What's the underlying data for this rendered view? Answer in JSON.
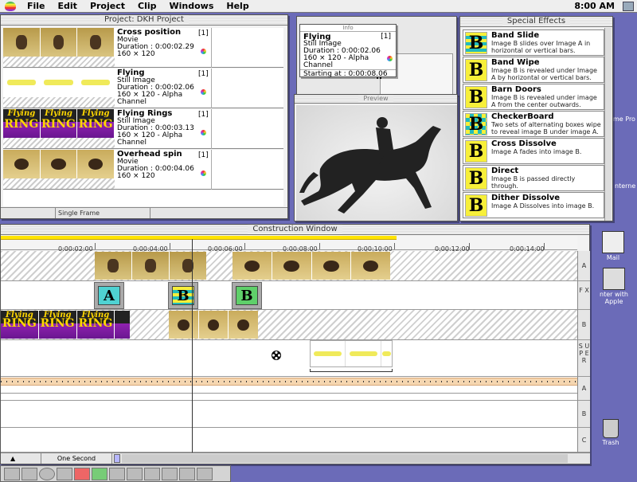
{
  "menubar": {
    "items": [
      "File",
      "Edit",
      "Project",
      "Clip",
      "Windows",
      "Help"
    ],
    "clock": "8:00 AM"
  },
  "project": {
    "title": "Project: DKH Project",
    "footer_label": "Single Frame",
    "clips": [
      {
        "name": "Cross position",
        "type": "Movie",
        "duration": "Duration : 0:00:02.29",
        "size": "160 × 120",
        "index": "[1]"
      },
      {
        "name": "Flying",
        "type": "Still Image",
        "duration": "Duration : 0:00:02.06",
        "size": "160 × 120 - Alpha Channel",
        "index": "[1]"
      },
      {
        "name": "Flying Rings",
        "type": "Still Image",
        "duration": "Duration : 0:00:03.13",
        "size": "160 × 120 - Alpha Channel",
        "index": "[1]"
      },
      {
        "name": "Overhead spin",
        "type": "Movie",
        "duration": "Duration : 0:00:04.06",
        "size": "160 × 120",
        "index": "[1]"
      }
    ],
    "ring_text": [
      "Flying",
      "RING"
    ]
  },
  "info": {
    "title": "Info",
    "name": "Flying",
    "index": "[1]",
    "type": "Still Image",
    "duration": "Duration : 0:00:02.06",
    "size": "160 × 120 - Alpha Channel",
    "start": "Starting at : 0:00:08.06"
  },
  "preview": {
    "title": "Preview"
  },
  "effects": {
    "title": "Special Effects",
    "items": [
      {
        "name": "Band Slide",
        "desc": "Image B slides over Image A in horizontal or vertical bars.",
        "glyph": "B"
      },
      {
        "name": "Band Wipe",
        "desc": "Image B is revealed under Image A by horizontal or vertical bars.",
        "glyph": "B"
      },
      {
        "name": "Barn Doors",
        "desc": "Image B is revealed under image A from the center outwards.",
        "glyph": "B"
      },
      {
        "name": "CheckerBoard",
        "desc": "Two sets of alternating boxes wipe to reveal image B under image A.",
        "glyph": "B"
      },
      {
        "name": "Cross Dissolve",
        "desc": "Image A fades into image B.",
        "glyph": "B"
      },
      {
        "name": "Direct",
        "desc": "Image B is passed directly through.",
        "glyph": "B"
      },
      {
        "name": "Dither Dissolve",
        "desc": "Image A Dissolves into image B.",
        "glyph": "B"
      }
    ]
  },
  "construction": {
    "title": "Construction Window",
    "ticks": [
      "0:00:02:00",
      "0:00:04:00",
      "0:00:06:00",
      "0:00:08:00",
      "0:00:10:00",
      "0:00:12:00",
      "0:00:14:00"
    ],
    "track_labels": {
      "a": "A",
      "fx": "F X",
      "b": "B",
      "super": "S U P E R",
      "audio_a": "A",
      "audio_b": "B",
      "audio_c": "C"
    },
    "timescale": "One Second",
    "ring_text": [
      "Flying",
      "RING"
    ]
  },
  "desktop": {
    "mail": "Mail",
    "enter": "nter with Apple",
    "trash": "Trash",
    "side1": "me Pro",
    "side2": "nterne"
  },
  "colors": {
    "desktop": "#6b6bb8",
    "effect_yellow": "#f7ef3a",
    "effect_teal": "#4fd2d2",
    "ruler_yellow": "#ffe400"
  }
}
